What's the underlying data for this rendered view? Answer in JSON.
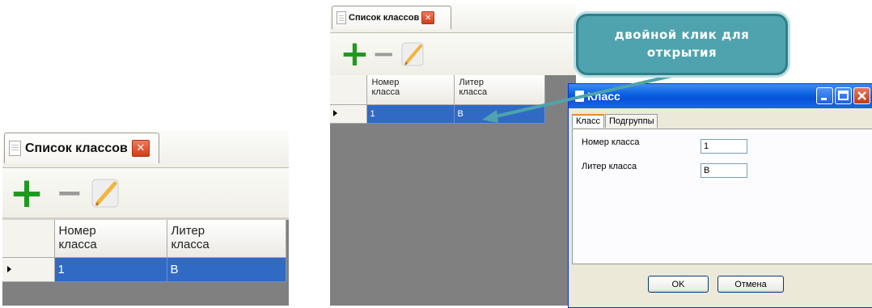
{
  "panel": {
    "tab_title": "Список классов",
    "tab_close": "✕",
    "toolbar": {
      "add": "+",
      "remove": "−"
    },
    "columns": [
      {
        "line1": "Номер",
        "line2": "класса"
      },
      {
        "line1": "Литер",
        "line2": "класса"
      }
    ],
    "rows": [
      {
        "number": "1",
        "letter": "В"
      }
    ]
  },
  "dialog": {
    "title": "Класс",
    "tabs": [
      "Класс",
      "Подгруппы"
    ],
    "fields": [
      {
        "label": "Номер класса",
        "value": "1"
      },
      {
        "label": "Литер класса",
        "value": "В"
      }
    ],
    "ok": "OK",
    "cancel": "Отмена"
  },
  "callout": {
    "text": "двойной клик для открытия"
  },
  "colors": {
    "selection": "#316ac5",
    "callout": "#4ea3ae",
    "plus": "#1f9a1f",
    "titlebar": "#0a5ee0"
  },
  "icons": [
    "doc-icon",
    "close-icon",
    "plus-icon",
    "minus-icon",
    "pencil-icon",
    "row-pointer-icon"
  ]
}
